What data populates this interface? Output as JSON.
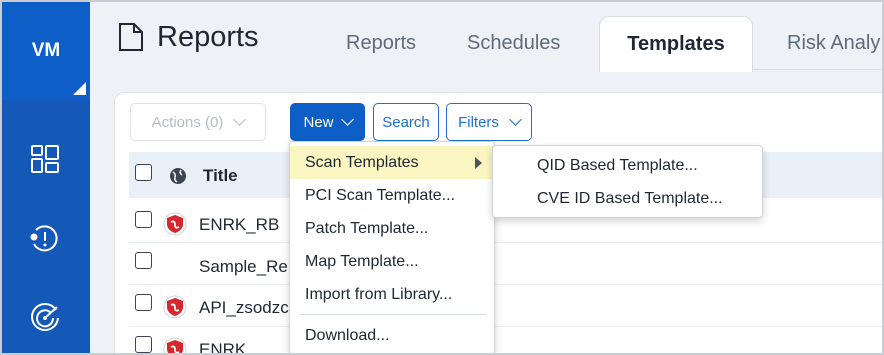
{
  "rail": {
    "logo": "VM"
  },
  "header": {
    "title": "Reports",
    "tabs": [
      "Reports",
      "Schedules",
      "Templates",
      "Risk Analy"
    ]
  },
  "toolbar": {
    "actions_label": "Actions (0)",
    "new_label": "New",
    "search_label": "Search",
    "filters_label": "Filters"
  },
  "table": {
    "column_title": "Title",
    "rows": [
      "ENRK_RB",
      "Sample_Re",
      "API_zsodzc",
      "ENRK"
    ]
  },
  "new_menu": {
    "items": [
      "Scan Templates",
      "PCI Scan Template...",
      "Patch Template...",
      "Map Template...",
      "Import from Library...",
      "Download..."
    ],
    "highlighted": "Scan Templates"
  },
  "scan_templates_submenu": {
    "items": [
      "QID Based Template...",
      "CVE ID Based Template..."
    ]
  },
  "colors": {
    "rail": "#1459b8",
    "accent": "#0d5fc7",
    "highlight": "#fbf5c2",
    "shield_red": "#d9262c"
  },
  "icons": [
    "document-icon",
    "dashboard-icon",
    "alert-clock-icon",
    "radar-icon",
    "globe-icon",
    "shield-icon",
    "chevron-down-icon",
    "caret-right-icon"
  ]
}
